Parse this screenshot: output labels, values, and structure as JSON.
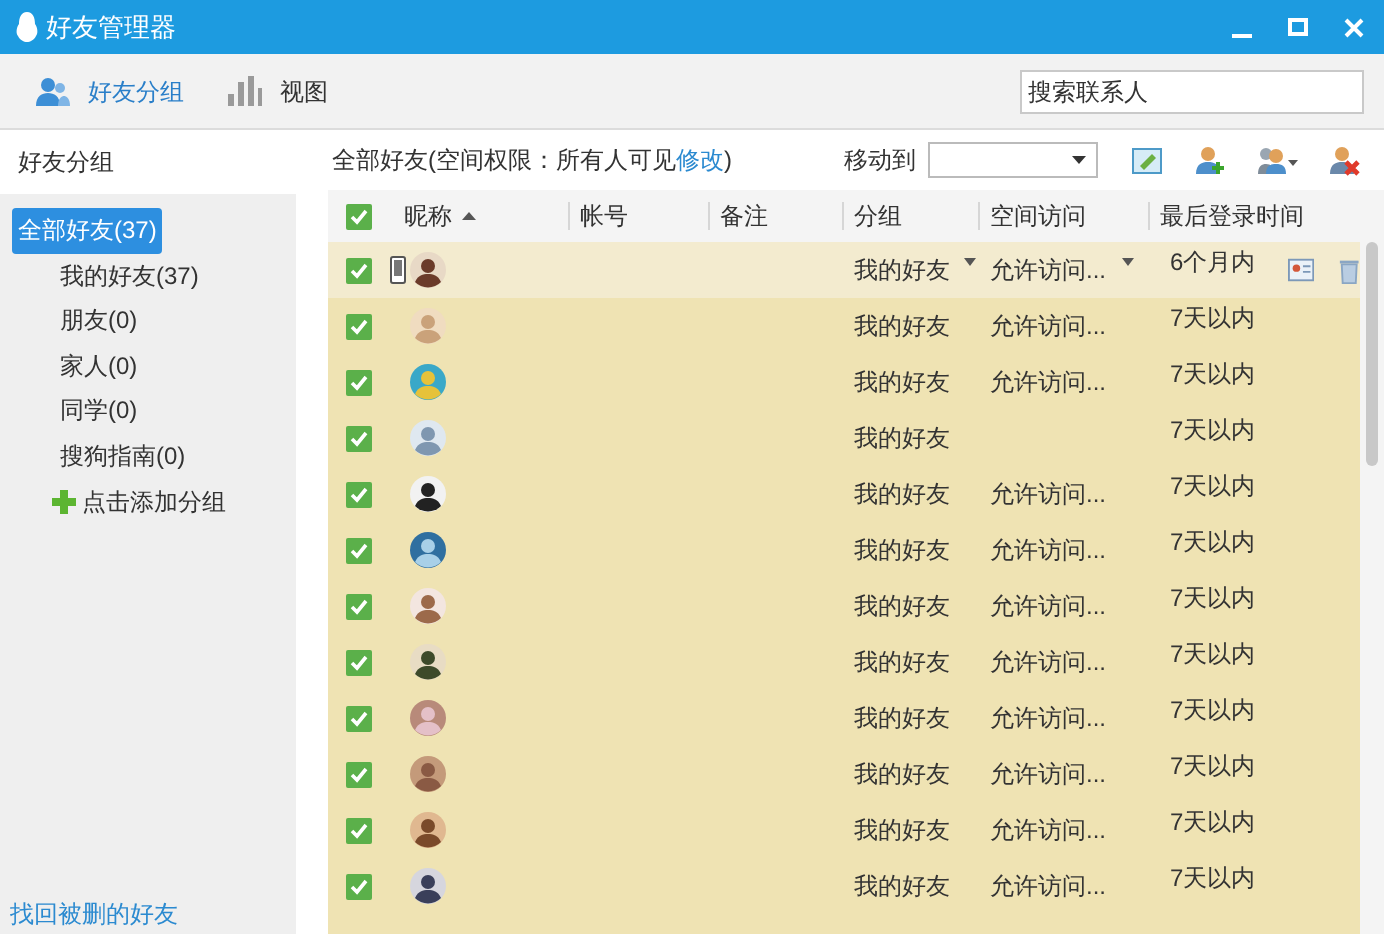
{
  "window": {
    "title": "好友管理器"
  },
  "toolbar": {
    "tabs": [
      {
        "label": "好友分组",
        "selected": true
      },
      {
        "label": "视图",
        "selected": false
      }
    ],
    "search": {
      "placeholder": "搜索联系人"
    }
  },
  "sidebar": {
    "title": "好友分组",
    "groups": [
      {
        "label": "全部好友(37)",
        "selected": true,
        "children": [
          {
            "label": "我的好友(37)",
            "selected": false
          },
          {
            "label": "朋友(0)",
            "selected": false
          },
          {
            "label": "家人(0)",
            "selected": false
          },
          {
            "label": "同学(0)",
            "selected": false
          },
          {
            "label": "搜狗指南(0)",
            "selected": false
          }
        ]
      }
    ],
    "add_group": "点击添加分组",
    "recover_link": "找回被删的好友"
  },
  "list_header": {
    "summary": "全部好友(空间权限：所有人可见",
    "link": "修改",
    "summary_end": ")",
    "move_to": "移动到"
  },
  "table": {
    "all_checked": true,
    "columns": [
      {
        "label": "昵称",
        "sorted": true
      },
      {
        "label": "帐号",
        "sorted": false
      },
      {
        "label": "备注",
        "sorted": false
      },
      {
        "label": "分组",
        "sorted": false
      },
      {
        "label": "空间访问",
        "sorted": false
      },
      {
        "label": "最后登录时间",
        "sorted": false
      }
    ],
    "rows": [
      {
        "checked": true,
        "highlighted": true,
        "mobile": true,
        "group": "我的好友",
        "access": "允许访问...",
        "last_login": "6个月内"
      },
      {
        "checked": true,
        "highlighted": false,
        "mobile": false,
        "group": "我的好友",
        "access": "允许访问...",
        "last_login": "7天以内"
      },
      {
        "checked": true,
        "highlighted": false,
        "mobile": false,
        "group": "我的好友",
        "access": "允许访问...",
        "last_login": "7天以内"
      },
      {
        "checked": true,
        "highlighted": false,
        "mobile": false,
        "group": "我的好友",
        "last_login": "7天以内"
      },
      {
        "checked": true,
        "highlighted": false,
        "mobile": false,
        "group": "我的好友",
        "access": "允许访问...",
        "last_login": "7天以内"
      },
      {
        "checked": true,
        "highlighted": false,
        "mobile": false,
        "group": "我的好友",
        "access": "允许访问...",
        "last_login": "7天以内"
      },
      {
        "checked": true,
        "highlighted": false,
        "mobile": false,
        "group": "我的好友",
        "access": "允许访问...",
        "last_login": "7天以内"
      },
      {
        "checked": true,
        "highlighted": false,
        "mobile": false,
        "group": "我的好友",
        "access": "允许访问...",
        "last_login": "7天以内"
      },
      {
        "checked": true,
        "highlighted": false,
        "mobile": false,
        "group": "我的好友",
        "access": "允许访问...",
        "last_login": "7天以内"
      },
      {
        "checked": true,
        "highlighted": false,
        "mobile": false,
        "group": "我的好友",
        "access": "允许访问...",
        "last_login": "7天以内"
      },
      {
        "checked": true,
        "highlighted": false,
        "mobile": false,
        "group": "我的好友",
        "access": "允许访问...",
        "last_login": "7天以内"
      },
      {
        "checked": true,
        "highlighted": false,
        "mobile": false,
        "group": "我的好友",
        "access": "允许访问...",
        "last_login": "7天以内"
      }
    ]
  }
}
